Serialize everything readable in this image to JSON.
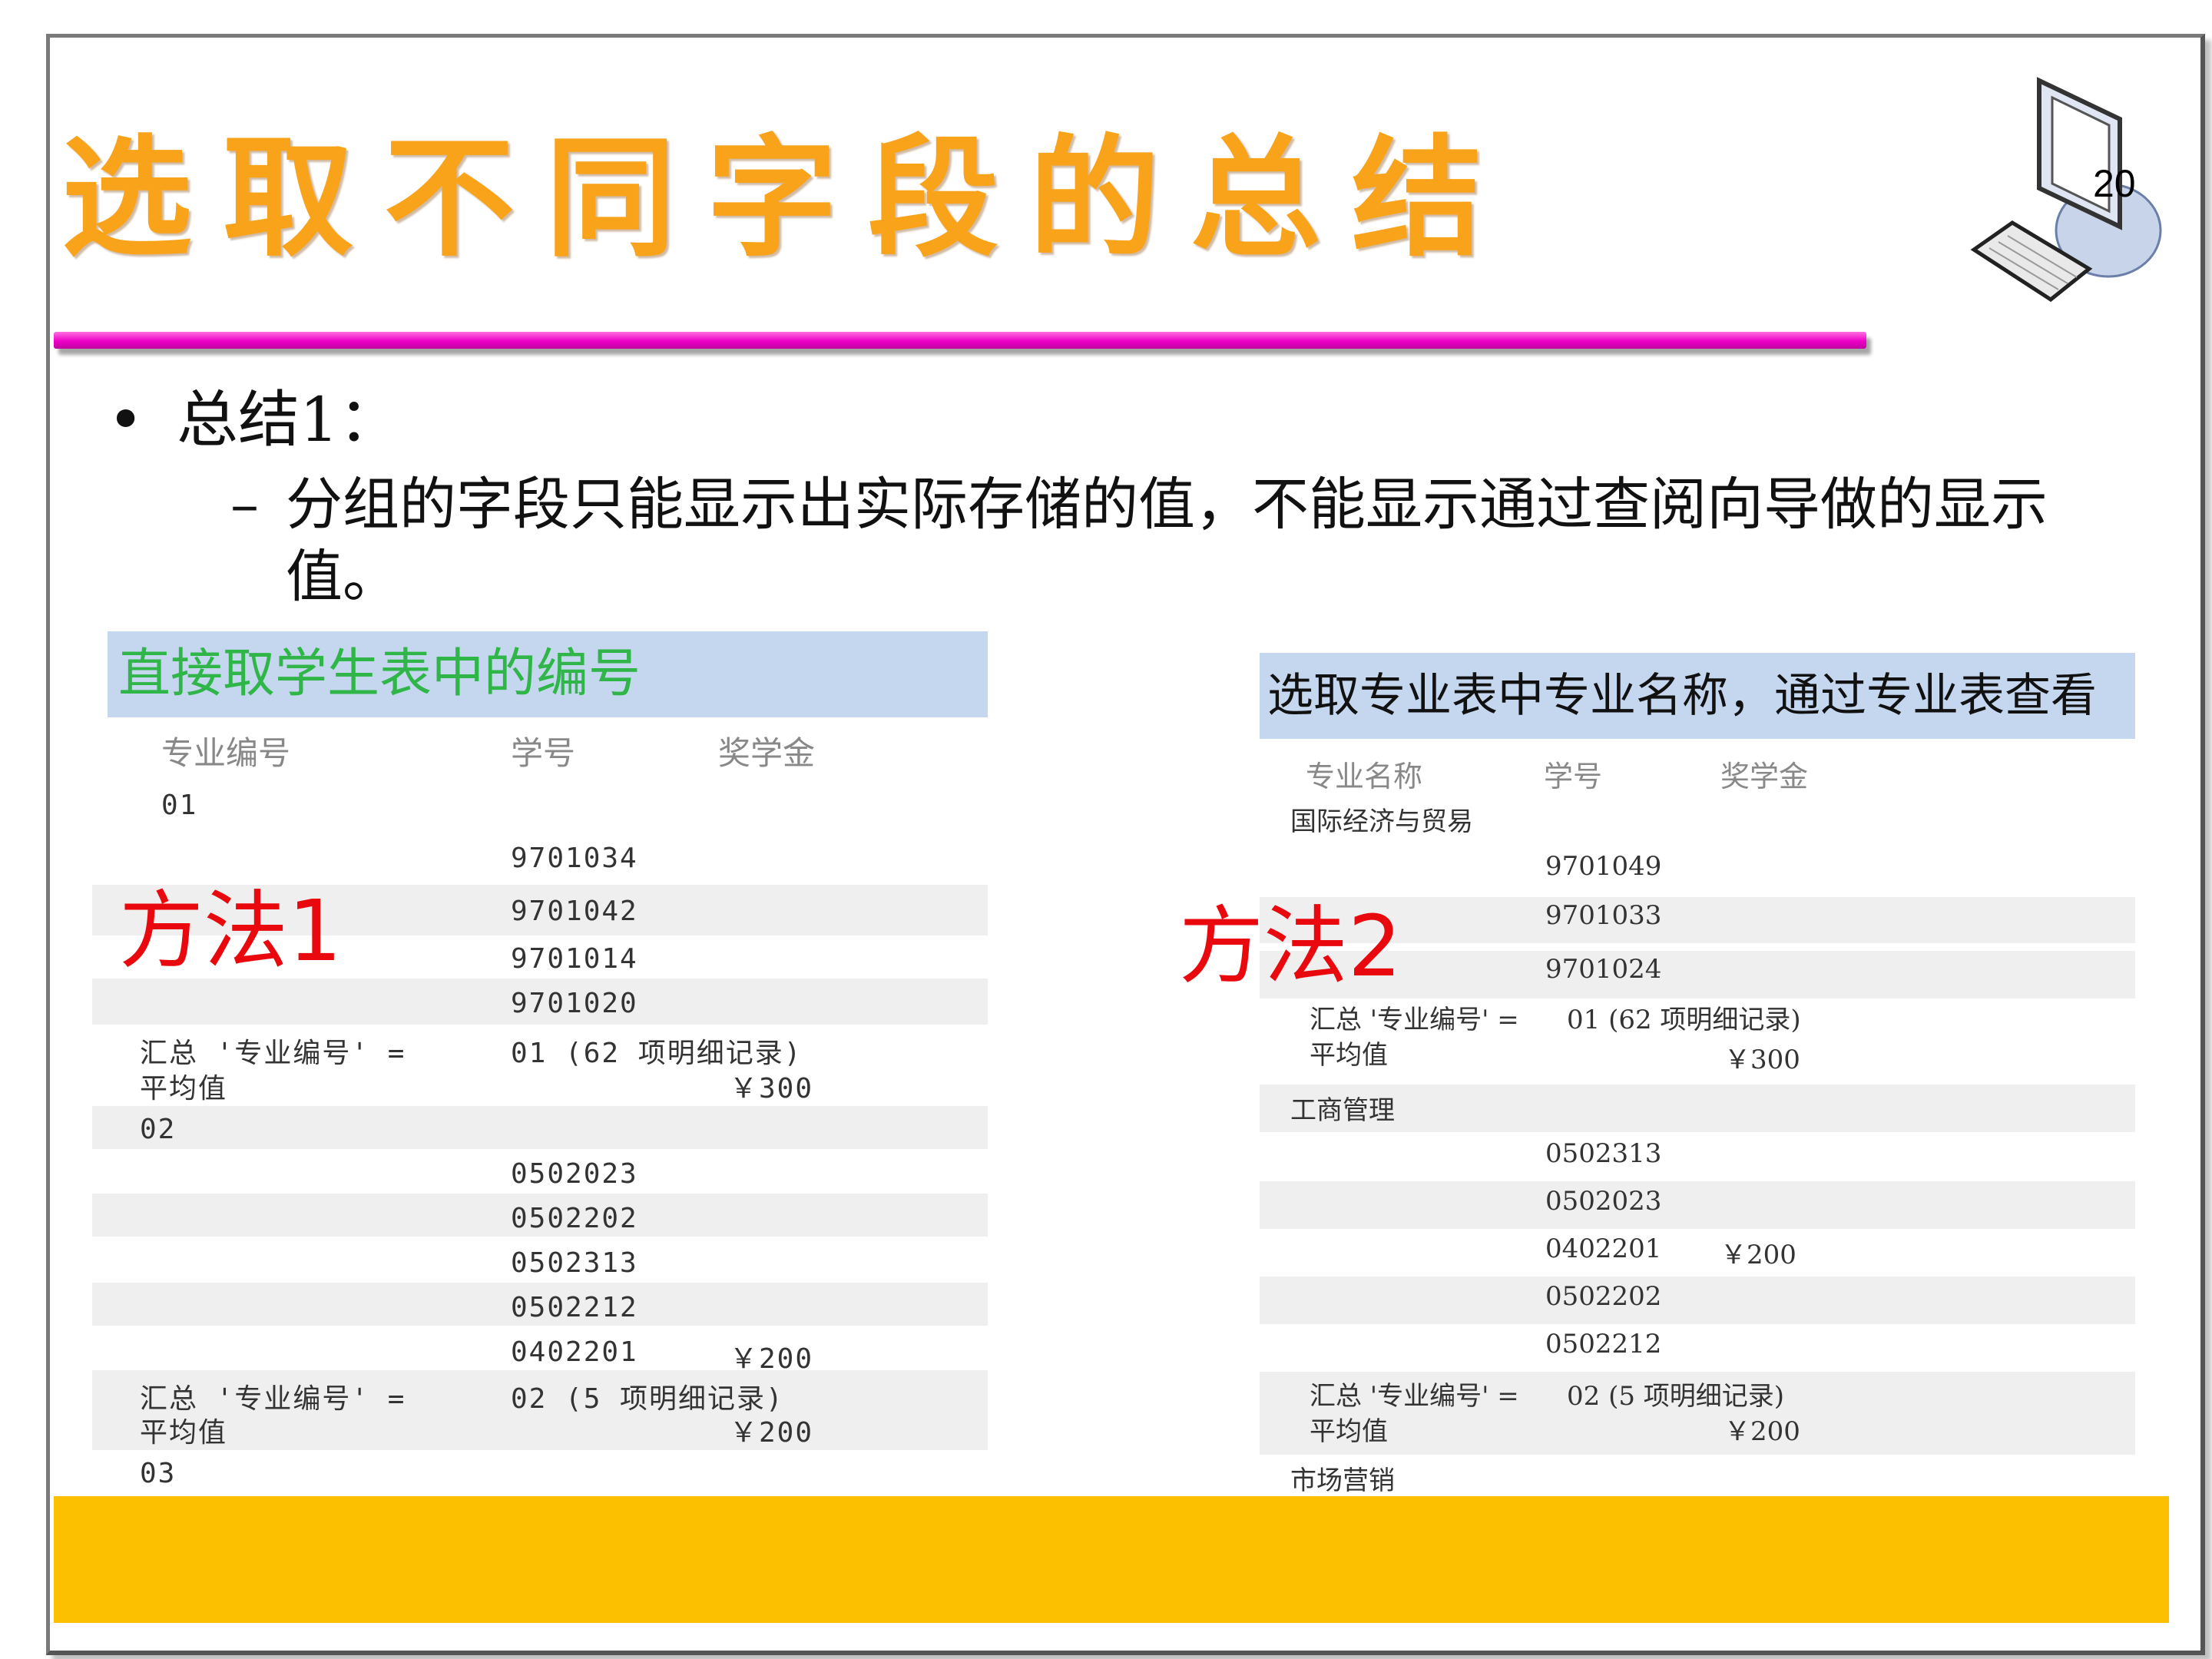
{
  "slide": {
    "title": "选取不同字段的总结",
    "page_number": "20",
    "bullet": "总结1：",
    "sub_dash": "–",
    "sub_text": "分组的字段只能显示出实际存储的值，不能显示通过查阅向导做的显示值。",
    "colors": {
      "title": "#f9a31a",
      "rule": "#ee00c8",
      "footer": "#fcc000",
      "method": "#e8080e",
      "caption_bg": "#c5d7ef"
    }
  },
  "panel1": {
    "caption": "直接取学生表中的编号",
    "method_label": "方法1",
    "headers": [
      "专业编号",
      "学号",
      "奖学金"
    ],
    "group1": "01",
    "ids1": [
      "9701034",
      "9701042",
      "9701014",
      "9701020"
    ],
    "summary1_a": "汇总 '专业编号' =",
    "summary1_b": "01 (62 项明细记录)",
    "avg_label": "平均值",
    "avg1": "￥300",
    "group2": "02",
    "ids2": [
      "0502023",
      "0502202",
      "0502313",
      "0502212",
      "0402201"
    ],
    "money2": "￥200",
    "summary2_a": "汇总 '专业编号' =",
    "summary2_b": "02 (5 项明细记录)",
    "avg2": "￥200",
    "group3": "03"
  },
  "panel2": {
    "caption": "选取专业表中专业名称，通过专业表查看",
    "method_label": "方法2",
    "headers": [
      "专业名称",
      "学号",
      "奖学金"
    ],
    "group1": "国际经济与贸易",
    "ids1": [
      "9701049",
      "9701033",
      "9701024"
    ],
    "summary1_a": "汇总 '专业编号' =",
    "summary1_b": "01 (62 项明细记录)",
    "avg_label": "平均值",
    "avg1": "￥300",
    "group2": "工商管理",
    "ids2": [
      "0502313",
      "0502023",
      "0402201",
      "0502202",
      "0502212"
    ],
    "money2": "￥200",
    "summary2_a": "汇总 '专业编号' =",
    "summary2_b": "02 (5 项明细记录)",
    "avg2": "￥200",
    "group3": "市场营销"
  }
}
